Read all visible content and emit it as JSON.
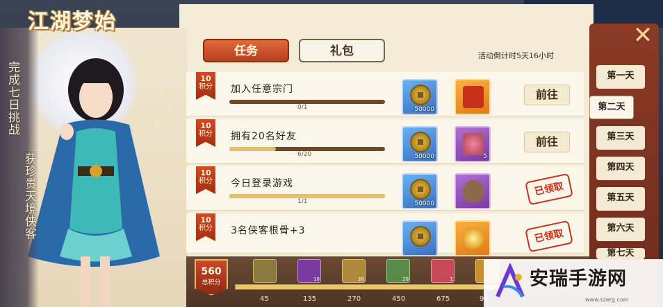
{
  "event": {
    "title": "江湖梦始",
    "tagline_left": "完成七日挑战",
    "tagline_right": "获珍贵天境侠客",
    "countdown": "活动倒计时5天16小时"
  },
  "tabs": [
    {
      "label": "任务",
      "active": true
    },
    {
      "label": "礼包",
      "active": false
    }
  ],
  "tasks": [
    {
      "points": "10",
      "points_label": "积分",
      "title": "加入任意宗门",
      "progress_text": "0/1",
      "progress": 0,
      "rewards": [
        {
          "icon": "copper-coin-icon",
          "qty": "50000"
        },
        {
          "icon": "red-envelope-icon",
          "qty": ""
        }
      ],
      "action": "前往",
      "claimed": false
    },
    {
      "points": "10",
      "points_label": "积分",
      "title": "拥有20名好友",
      "progress_text": "6/20",
      "progress": 0.3,
      "rewards": [
        {
          "icon": "copper-coin-icon",
          "qty": "50000"
        },
        {
          "icon": "flower-bouquet-icon",
          "qty": "5"
        }
      ],
      "action": "前往",
      "claimed": false
    },
    {
      "points": "10",
      "points_label": "积分",
      "title": "今日登录游戏",
      "progress_text": "1/1",
      "progress": 1,
      "rewards": [
        {
          "icon": "copper-coin-icon",
          "qty": "50000"
        },
        {
          "icon": "money-bag-icon",
          "qty": ""
        }
      ],
      "action": "已领取",
      "claimed": true
    },
    {
      "points": "10",
      "points_label": "积分",
      "title": "3名侠客根骨+3",
      "progress_text": "",
      "progress": 1,
      "rewards": [
        {
          "icon": "copper-coin-icon",
          "qty": ""
        },
        {
          "icon": "golden-orb-icon",
          "qty": ""
        }
      ],
      "action": "已领取",
      "claimed": true
    }
  ],
  "days": [
    "第一天",
    "第二天",
    "第三天",
    "第四天",
    "第五天",
    "第六天",
    "第七天"
  ],
  "active_day": 1,
  "total_points": {
    "value": "560",
    "label": "总积分"
  },
  "milestones": [
    {
      "value": "45",
      "icon": "scroll-icon",
      "qty": ""
    },
    {
      "value": "135",
      "icon": "purple-chest-icon",
      "qty": "10"
    },
    {
      "value": "270",
      "icon": "gold-scroll-icon",
      "qty": "20"
    },
    {
      "value": "450",
      "icon": "green-token-icon",
      "qty": "20"
    },
    {
      "value": "675",
      "icon": "red-card-icon",
      "qty": "1"
    },
    {
      "value": "94",
      "icon": "gold-item-icon",
      "qty": ""
    }
  ],
  "watermark": {
    "name": "安瑞手游网",
    "url": "www.szerg.com"
  },
  "colors": {
    "accent": "#c8482a",
    "parchment": "#f5ecd8",
    "stamp": "#c8301a"
  }
}
